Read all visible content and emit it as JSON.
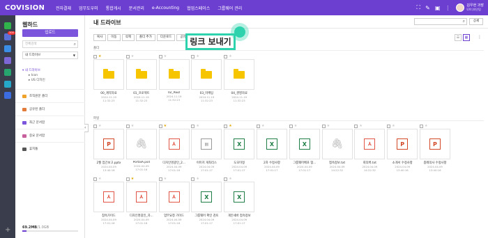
{
  "header": {
    "logo": "COVISION",
    "menu": [
      "전자결재",
      "업무도우미",
      "통합게시",
      "문서관리",
      "e-Accounting",
      "협업스페이스",
      "그룹웨어 관리"
    ],
    "user_name": "김우현 과장",
    "user_dept": "UX디자인팀",
    "icons": [
      "sitemap-icon",
      "pen-icon",
      "window-icon",
      "grid-icon"
    ]
  },
  "rail": {
    "badge": "300"
  },
  "sidebar": {
    "title": "웹하드",
    "upload_label": "업로드",
    "search_placeholder": "전체검색",
    "select_value": "내 드라이브",
    "tree": {
      "root": "내 드라이브",
      "children": [
        "Icon",
        "US 디자인"
      ]
    },
    "items": [
      "조직원문 폴더",
      "공유된 폴더",
      "최근 문서함",
      "중요 문서함",
      "휴지통"
    ],
    "storage_used": "69.2MB",
    "storage_total": "/1.0GB",
    "storage_fraction": 0.07
  },
  "main": {
    "title": "내 드라이브",
    "detail_label": "상세",
    "toolbar": [
      "복사",
      "이동",
      "삭제",
      "폴더 추가",
      "다운로드",
      "공유"
    ],
    "callout": "링크 보내기",
    "folder_section": "폴더",
    "file_section": "파일",
    "folders": [
      {
        "name": "00_계약자료",
        "date": "2024.11.19",
        "time": "11:32:23",
        "starred": true
      },
      {
        "name": "01_프로젝트",
        "date": "2024.11.19",
        "time": "11:32:23",
        "starred": false
      },
      {
        "name": "02_R&D",
        "date": "2024.11.19",
        "time": "11:32:23",
        "starred": false
      },
      {
        "name": "03_마케팅",
        "date": "2024.11.19",
        "time": "11:32:23",
        "starred": false
      },
      {
        "name": "04_경영자료",
        "date": "2024.11.19",
        "time": "11:32:23",
        "starred": false
      }
    ],
    "files": [
      {
        "name": "2월 업간보고.pptx",
        "type": "ppt",
        "date": "2024.04.09",
        "time": "13:40:16",
        "starred": false
      },
      {
        "name": "PortalA.psd",
        "type": "clip",
        "date": "2024.04.09",
        "time": "17:01:16",
        "starred": false
      },
      {
        "name": "디자인명광인_2...",
        "type": "pdf",
        "date": "2024.04.09",
        "time": "17:01:16",
        "starred": true
      },
      {
        "name": "이미지 게최리스",
        "type": "zip",
        "date": "2024.04.09",
        "time": "17:01:17",
        "starred": false
      },
      {
        "name": "도모미정",
        "type": "xls",
        "date": "2024.04.09",
        "time": "17:01:17",
        "starred": true
      },
      {
        "name": "2차 수정사항",
        "type": "xls",
        "date": "2024.04.09",
        "time": "17:01:17",
        "starred": false
      },
      {
        "name": "그룹웨어배포 협...",
        "type": "xls",
        "date": "2024.04.09",
        "time": "17:01:17",
        "starred": false
      },
      {
        "name": "접속정보.txt",
        "type": "clip",
        "date": "2024.04.09",
        "time": "14:22:32",
        "starred": false
      },
      {
        "name": "회의록.txt",
        "type": "pdf",
        "date": "2024.04.09",
        "time": "14:22:32",
        "starred": false
      },
      {
        "name": "소개서 수정사항",
        "type": "ppt",
        "date": "2024.04.09",
        "time": "13:40:16",
        "starred": false
      },
      {
        "name": "종례의사 수정사항",
        "type": "ppt",
        "date": "2024.04.09",
        "time": "13:40:16",
        "starred": false
      },
      {
        "name": "참속가이드",
        "type": "pdf",
        "date": "2024.04.09",
        "time": "17:01:16",
        "starred": false
      },
      {
        "name": "디자인명광인_자...",
        "type": "pdf",
        "date": "2024.04.09",
        "time": "17:01:16",
        "starred": true
      },
      {
        "name": "업무요청 가이드",
        "type": "pdf",
        "date": "2024.04.09",
        "time": "17:01:16",
        "starred": false
      },
      {
        "name": "그룹웨어 확인 검토",
        "type": "xls",
        "date": "2024.04.09",
        "time": "17:01:17",
        "starred": false
      },
      {
        "name": "개인세바 접속정보",
        "type": "xls",
        "date": "2024.04.09",
        "time": "17:01:17",
        "starred": false
      }
    ]
  }
}
